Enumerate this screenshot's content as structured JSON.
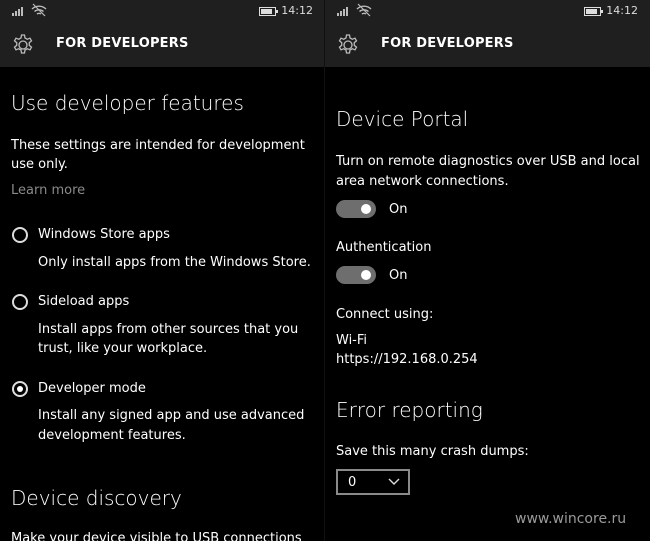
{
  "left": {
    "status": {
      "time": "14:12"
    },
    "header": {
      "title": "FOR DEVELOPERS"
    },
    "section_title": "Use developer features",
    "intro_line1": "These settings are intended for development",
    "intro_line2": "use only.",
    "learn_more": "Learn more",
    "options": [
      {
        "label": "Windows Store apps",
        "desc1": "Only install apps from the Windows Store.",
        "desc2": "",
        "selected": false
      },
      {
        "label": "Sideload apps",
        "desc1": "Install apps from other sources that you",
        "desc2": "trust, like your workplace.",
        "selected": false
      },
      {
        "label": "Developer mode",
        "desc1": "Install any signed app and use advanced",
        "desc2": "development features.",
        "selected": true
      }
    ],
    "discovery_title": "Device discovery",
    "discovery_text": "Make your device visible to USB connections"
  },
  "right": {
    "status": {
      "time": "14:12"
    },
    "header": {
      "title": "FOR DEVELOPERS"
    },
    "portal_title": "Device Portal",
    "portal_text1": "Turn on remote diagnostics over USB and local",
    "portal_text2": "area network connections.",
    "portal_toggle": {
      "state_label": "On",
      "on": true
    },
    "auth_label": "Authentication",
    "auth_toggle": {
      "state_label": "On",
      "on": true
    },
    "connect_label": "Connect using:",
    "connect_type": "Wi-Fi",
    "connect_url": "https://192.168.0.254",
    "error_title": "Error reporting",
    "crash_label": "Save this many crash dumps:",
    "crash_value": "0"
  },
  "watermark": "www.wincore.ru",
  "colors": {
    "background": "#000000",
    "header": "#1f1f1f",
    "muted": "#8a8a8a",
    "toggle_track": "#6e6e6e"
  }
}
